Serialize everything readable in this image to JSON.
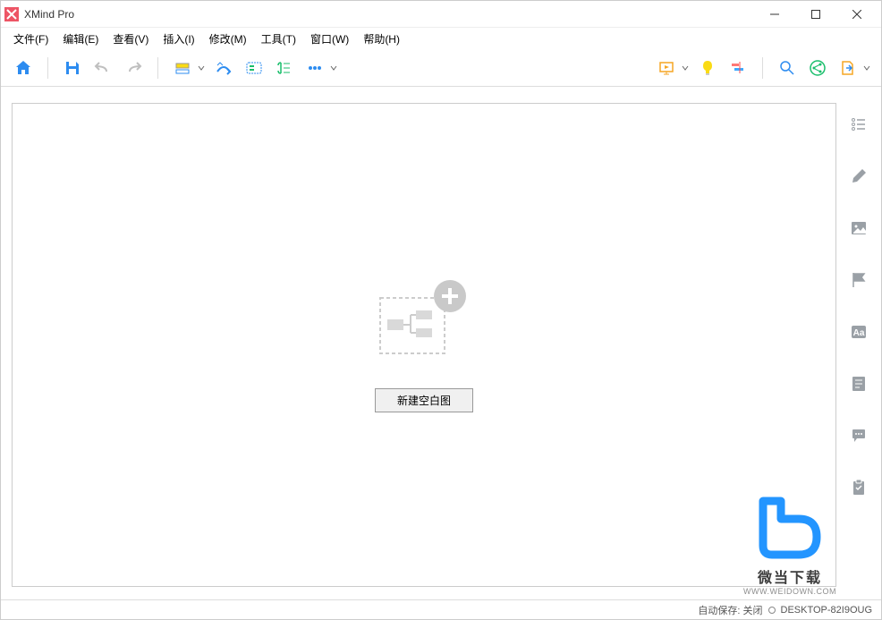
{
  "window": {
    "title": "XMind Pro"
  },
  "menubar": {
    "items": [
      {
        "label": "文件(F)"
      },
      {
        "label": "编辑(E)"
      },
      {
        "label": "查看(V)"
      },
      {
        "label": "插入(I)"
      },
      {
        "label": "修改(M)"
      },
      {
        "label": "工具(T)"
      },
      {
        "label": "窗口(W)"
      },
      {
        "label": "帮助(H)"
      }
    ]
  },
  "toolbar": {
    "icons": {
      "home": "home-icon",
      "save": "save-icon",
      "undo": "undo-icon",
      "redo": "redo-icon",
      "topic": "topic-icon",
      "relationship": "relationship-icon",
      "boundary": "boundary-icon",
      "summary": "summary-icon",
      "more": "more-icon",
      "presentation": "presentation-icon",
      "idea": "idea-icon",
      "gantt": "gantt-icon",
      "search": "search-icon",
      "share": "share-icon",
      "export": "export-icon"
    }
  },
  "canvas": {
    "new_blank_label": "新建空白图"
  },
  "sidebar": {
    "icons": {
      "outline": "outline-icon",
      "format": "brush-icon",
      "image": "image-icon",
      "marker": "flag-icon",
      "font": "font-icon",
      "notes": "notes-icon",
      "comments": "comments-icon",
      "task": "task-icon"
    }
  },
  "statusbar": {
    "autosave_label": "自动保存: 关闭",
    "hostname": "DESKTOP-82I9OUG"
  },
  "watermark": {
    "text": "微当下载",
    "url": "WWW.WEIDOWN.COM"
  },
  "colors": {
    "accent_blue": "#2d8cf0",
    "accent_orange": "#f5a623",
    "accent_green": "#19be6b",
    "accent_yellow": "#fadb14",
    "gray": "#bfbfbf"
  }
}
